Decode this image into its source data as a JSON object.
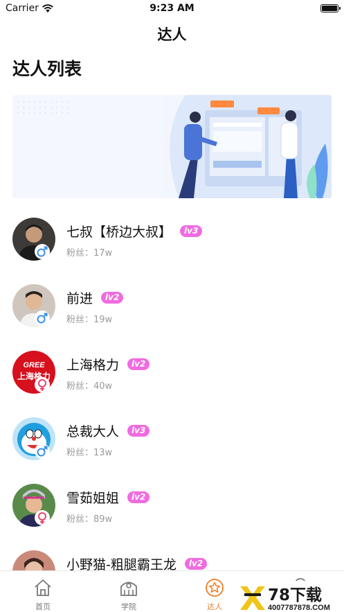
{
  "status_bar": {
    "carrier": "Carrier",
    "time": "9:23 AM"
  },
  "nav": {
    "title": "达人"
  },
  "section": {
    "title": "达人列表"
  },
  "influencers": [
    {
      "name": "七叔【桥边大叔】",
      "level": "lv3",
      "fans_label": "粉丝：",
      "fans": "17w",
      "gender": "male"
    },
    {
      "name": "前进",
      "level": "lv2",
      "fans_label": "粉丝：",
      "fans": "19w",
      "gender": "male"
    },
    {
      "name": "上海格力",
      "level": "lv2",
      "fans_label": "粉丝：",
      "fans": "40w",
      "gender": "female"
    },
    {
      "name": "总裁大人",
      "level": "lv3",
      "fans_label": "粉丝：",
      "fans": "13w",
      "gender": "male"
    },
    {
      "name": "雪茹姐姐",
      "level": "lv2",
      "fans_label": "粉丝：",
      "fans": "89w",
      "gender": "female"
    },
    {
      "name": "小野猫-粗腿霸王龙",
      "level": "lv2",
      "fans_label": "",
      "fans": "",
      "gender": "female"
    }
  ],
  "avatar_logo_text": {
    "brand": "GREE",
    "chinese": "上海格力"
  },
  "tabs": [
    {
      "label": "首页",
      "icon": "home-icon",
      "active": false
    },
    {
      "label": "学院",
      "icon": "academy-icon",
      "active": false
    },
    {
      "label": "达人",
      "icon": "star-icon",
      "active": true
    },
    {
      "label": "",
      "icon": "profile-icon",
      "active": false
    }
  ],
  "watermark": {
    "brand": "78下载",
    "url": "4007787878.COM"
  },
  "colors": {
    "accent": "#f07b22",
    "badge": "#f06be0",
    "male": "#3b8ee8",
    "female": "#e8456a"
  }
}
